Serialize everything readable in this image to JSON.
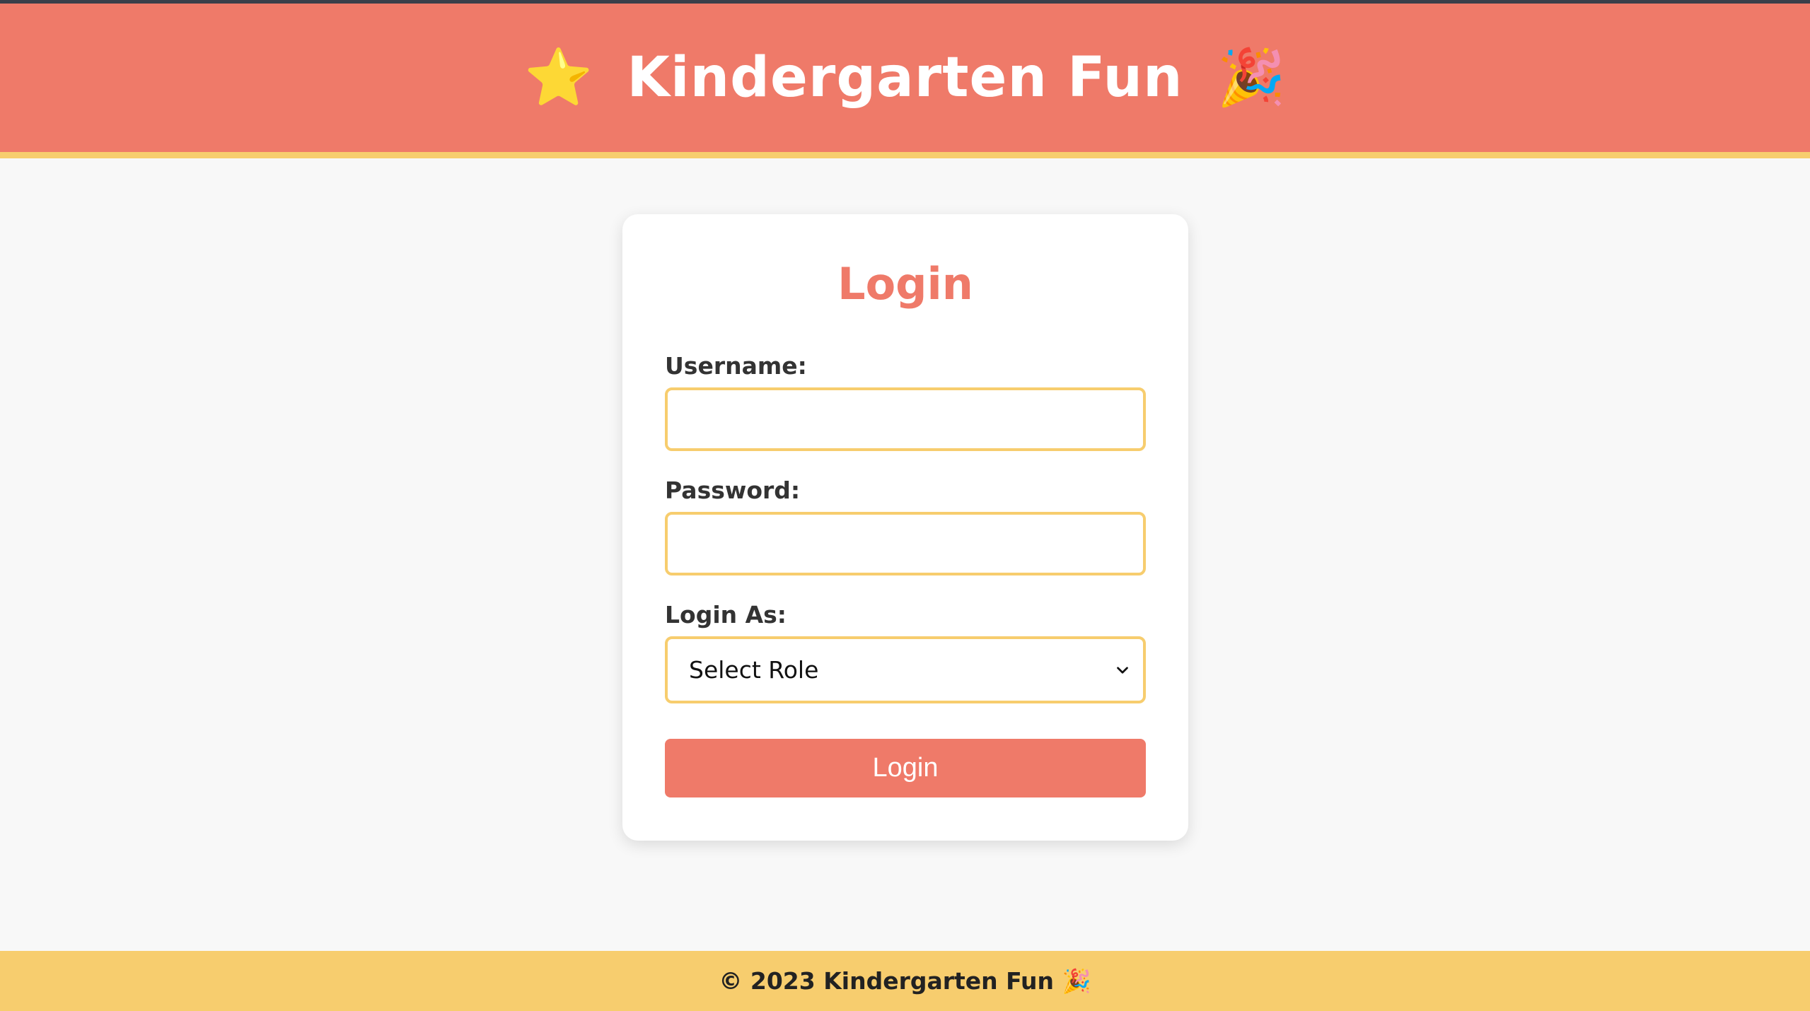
{
  "header": {
    "title": "Kindergarten Fun",
    "left_icon": "⭐",
    "right_icon": "🎉"
  },
  "login_form": {
    "title": "Login",
    "username_label": "Username:",
    "username_value": "",
    "password_label": "Password:",
    "password_value": "",
    "role_label": "Login As:",
    "role_selected": "Select Role",
    "submit_label": "Login"
  },
  "footer": {
    "text": "© 2023 Kindergarten Fun 🎉"
  },
  "colors": {
    "header_bg": "#ef7a69",
    "accent_yellow": "#f7cd6e",
    "page_bg": "#f8f8f8",
    "card_bg": "#ffffff"
  },
  "icons": {
    "left": "star-icon",
    "right": "party-popper-icon",
    "select_arrow": "chevron-down-icon"
  }
}
